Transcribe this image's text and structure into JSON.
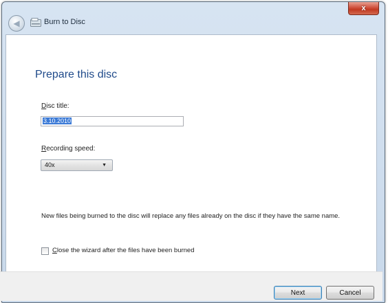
{
  "window": {
    "title": "Burn to Disc",
    "close_label": "x"
  },
  "page": {
    "heading": "Prepare this disc"
  },
  "disc_title": {
    "label_accel": "D",
    "label_rest": "isc title:",
    "value": "3.10.2010"
  },
  "recording_speed": {
    "label_accel": "R",
    "label_rest": "ecording speed:",
    "value": "40x",
    "arrow": "▼"
  },
  "info": {
    "text": "New files being burned to the disc will replace any files already on the disc if they have the same name."
  },
  "close_wizard": {
    "label_accel": "C",
    "label_rest": "lose the wizard after the files have been burned",
    "checked": false
  },
  "buttons": {
    "next": "Next",
    "cancel": "Cancel"
  }
}
